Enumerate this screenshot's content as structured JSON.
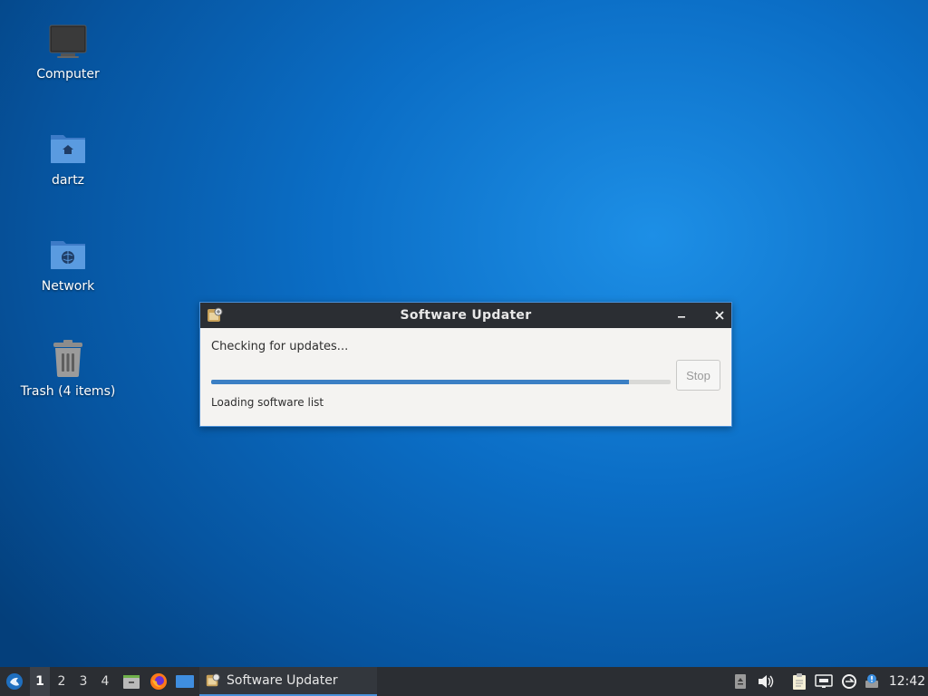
{
  "desktop": {
    "icons": [
      {
        "label": "Computer"
      },
      {
        "label": "dartz"
      },
      {
        "label": "Network"
      },
      {
        "label": "Trash (4 items)"
      }
    ]
  },
  "dialog": {
    "title": "Software Updater",
    "minimize_icon": "minimize-icon",
    "close_icon": "close-icon",
    "status_heading": "Checking for updates...",
    "progress_fraction": 0.91,
    "stop_label": "Stop",
    "status_detail": "Loading software list"
  },
  "taskbar": {
    "workspaces": [
      "1",
      "2",
      "3",
      "4"
    ],
    "active_workspace": "1",
    "task_label": "Software Updater",
    "clock": "12:42"
  },
  "colors": {
    "accent": "#4a90d9",
    "progress": "#3b7fc4",
    "taskbar": "#2b2e33"
  }
}
